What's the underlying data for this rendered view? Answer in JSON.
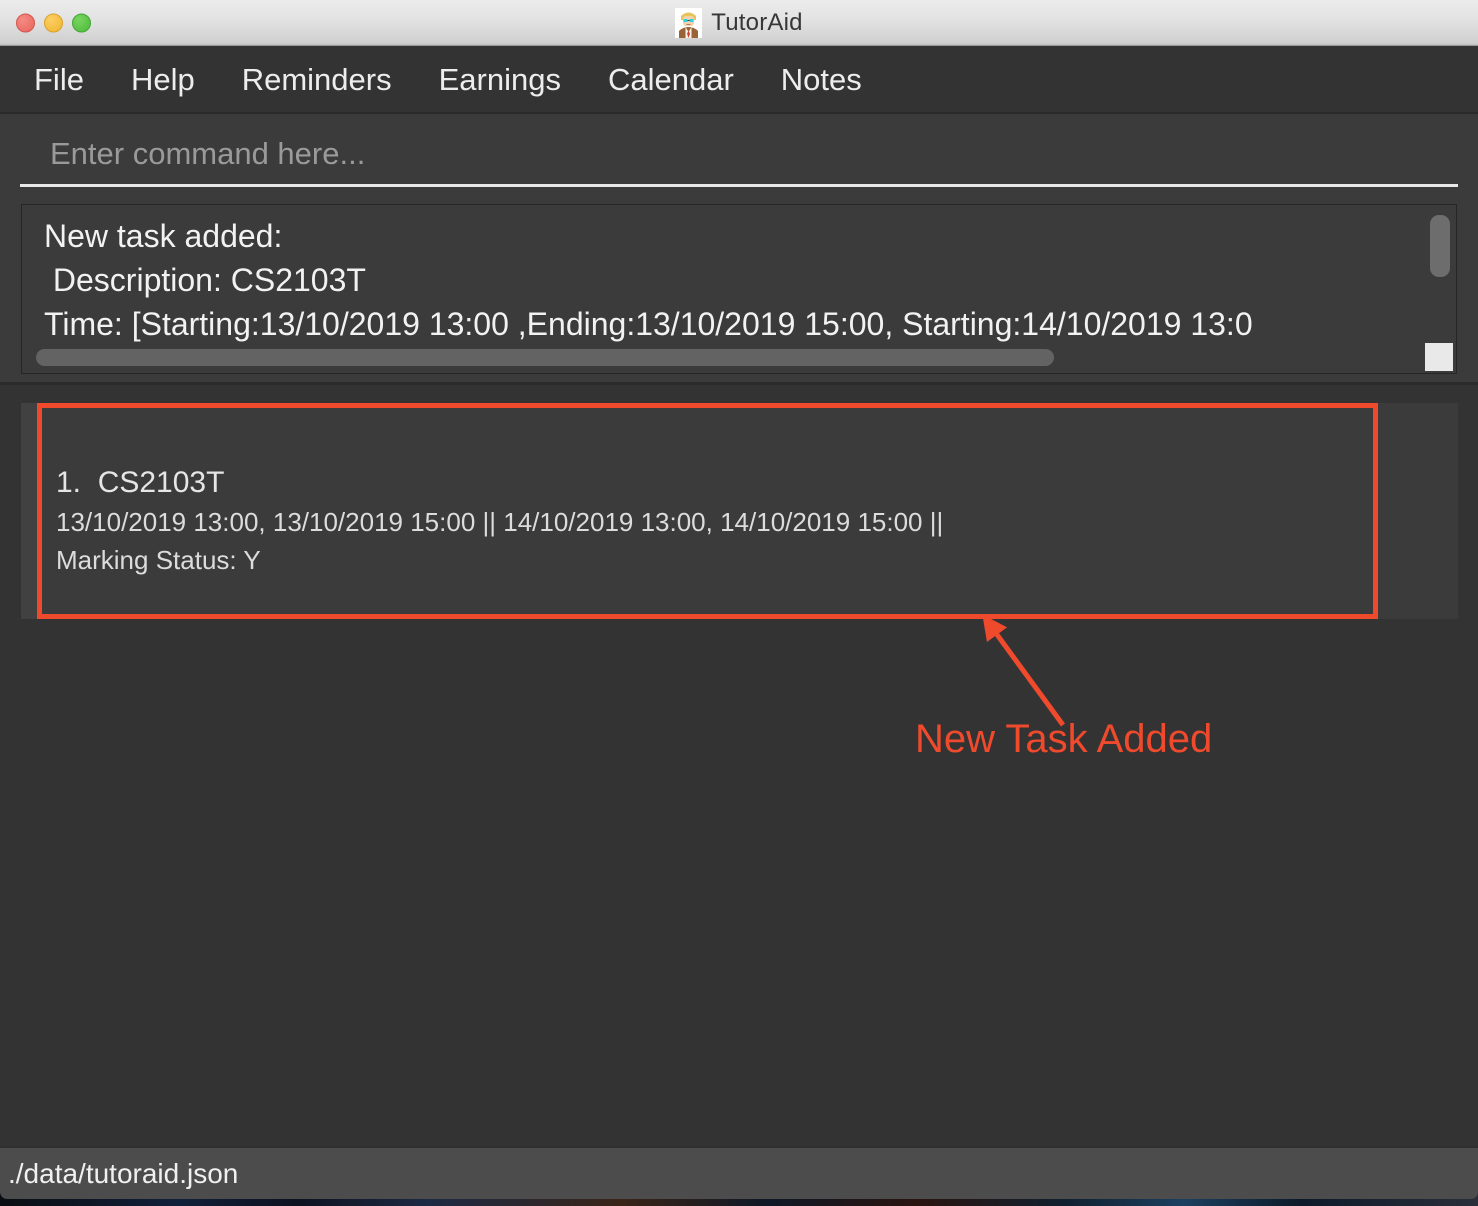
{
  "window": {
    "title": "TutorAid",
    "app_icon": "tutor-avatar-icon",
    "traffic_lights": {
      "close": "close-window-button",
      "minimize": "minimize-window-button",
      "maximize": "maximize-window-button"
    }
  },
  "menubar": {
    "items": [
      {
        "label": "File"
      },
      {
        "label": "Help"
      },
      {
        "label": "Reminders"
      },
      {
        "label": "Earnings"
      },
      {
        "label": "Calendar"
      },
      {
        "label": "Notes"
      }
    ]
  },
  "command": {
    "placeholder": "Enter command here...",
    "value": ""
  },
  "result_display": {
    "lines": [
      "New task added:",
      " Description: CS2103T",
      "Time: [Starting:13/10/2019 13:00 ,Ending:13/10/2019 15:00, Starting:14/10/2019 13:0"
    ],
    "full_text": "New task added:\n Description: CS2103T\nTime: [Starting:13/10/2019 13:00 ,Ending:13/10/2019 15:00, Starting:14/10/2019 13:0"
  },
  "task_list": {
    "items": [
      {
        "index": "1.",
        "name": "CS2103T",
        "times": "13/10/2019 13:00, 13/10/2019 15:00 || 14/10/2019 13:00, 14/10/2019 15:00 ||",
        "marking_status": "Marking Status: Y"
      }
    ]
  },
  "annotation": {
    "label": "New Task Added",
    "color": "#f04a2d",
    "highlight_color": "#f04a2d"
  },
  "statusbar": {
    "path": "./data/tutoraid.json"
  },
  "colors": {
    "window_chrome": "#333333",
    "panel_bg": "#3b3b3b",
    "titlebar_light": "#ececec",
    "accent_red": "#f04a2d",
    "text_primary": "#f2f2f2",
    "placeholder": "#9a9a9a"
  }
}
